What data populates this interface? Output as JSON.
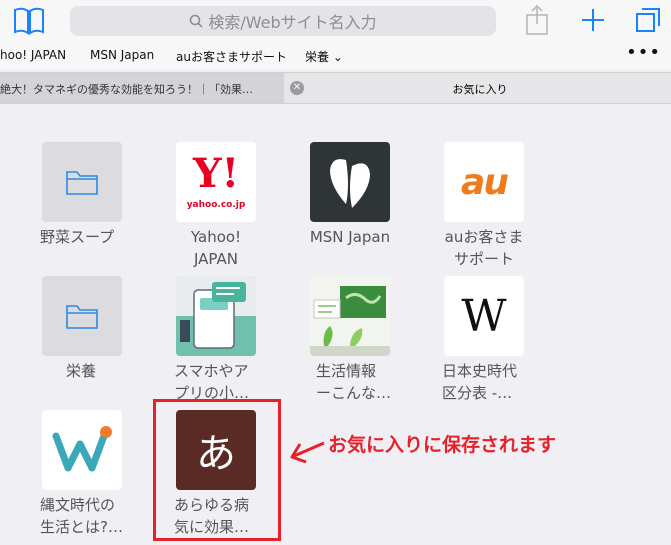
{
  "toolbar": {
    "search_placeholder": "検索/Webサイト名入力"
  },
  "bookmarks": {
    "items": [
      "hoo! JAPAN",
      "MSN Japan",
      "auお客さまサポート",
      "栄養 ⌄"
    ],
    "more": "•••"
  },
  "tabs": {
    "inactive_title": "絶大！タマネギの優秀な効能を知ろう！｜「効果…",
    "close": "✕",
    "active_title": "お気に入り"
  },
  "favorites": [
    {
      "label_lines": [
        "野菜スープ"
      ]
    },
    {
      "label_lines": [
        "Yahoo!",
        "JAPAN"
      ],
      "tile_text": "Y!",
      "tile_sub": "yahoo.co.jp"
    },
    {
      "label_lines": [
        "MSN Japan"
      ]
    },
    {
      "label_lines": [
        "auお客さま",
        "サポート"
      ],
      "tile_text": "au"
    },
    {
      "label_lines": [
        "栄養"
      ]
    },
    {
      "label_lines": [
        "スマホやア",
        "プリの小…"
      ]
    },
    {
      "label_lines": [
        "生活情報",
        "ーこんな…"
      ]
    },
    {
      "label_lines": [
        "日本史時代",
        "区分表 -…"
      ],
      "tile_text": "W"
    },
    {
      "label_lines": [
        "縄文時代の",
        "生活とは?…"
      ]
    },
    {
      "label_lines": [
        "あらゆる病",
        "気に効果…"
      ],
      "tile_text": "あ"
    }
  ],
  "annotation": {
    "text": "お気に入りに保存されます",
    "color": "#e8202a"
  }
}
